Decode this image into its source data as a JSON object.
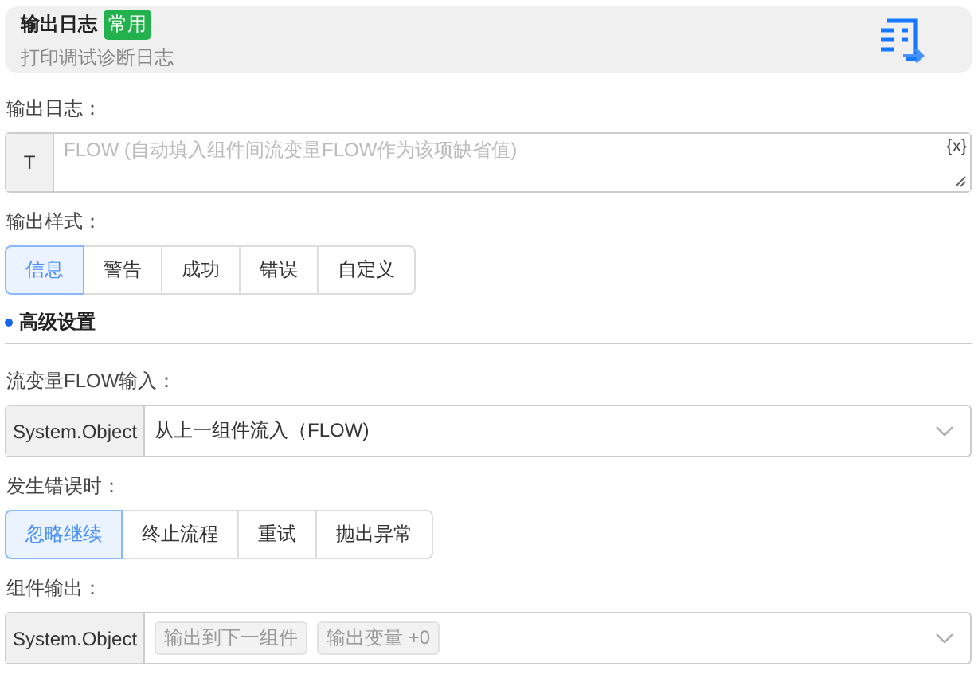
{
  "header": {
    "title": "输出日志",
    "badge": "常用",
    "subtitle": "打印调试诊断日志"
  },
  "log_field": {
    "label": "输出日志：",
    "prefix": "T",
    "placeholder": "FLOW (自动填入组件间流变量FLOW作为该项缺省值)",
    "var_button": "{x}"
  },
  "style": {
    "label": "输出样式：",
    "options": [
      {
        "label": "信息",
        "selected": true
      },
      {
        "label": "警告",
        "selected": false
      },
      {
        "label": "成功",
        "selected": false
      },
      {
        "label": "错误",
        "selected": false
      },
      {
        "label": "自定义",
        "selected": false
      }
    ]
  },
  "advanced": {
    "title": "高级设置"
  },
  "flow_input": {
    "label": "流变量FLOW输入：",
    "prefix": "System.Object",
    "value": "从上一组件流入（FLOW)"
  },
  "on_error": {
    "label": "发生错误时：",
    "options": [
      {
        "label": "忽略继续",
        "selected": true
      },
      {
        "label": "终止流程",
        "selected": false
      },
      {
        "label": "重试",
        "selected": false
      },
      {
        "label": "抛出异常",
        "selected": false
      }
    ]
  },
  "output": {
    "label": "组件输出：",
    "prefix": "System.Object",
    "tags": [
      "输出到下一组件",
      "输出变量 +0"
    ]
  }
}
